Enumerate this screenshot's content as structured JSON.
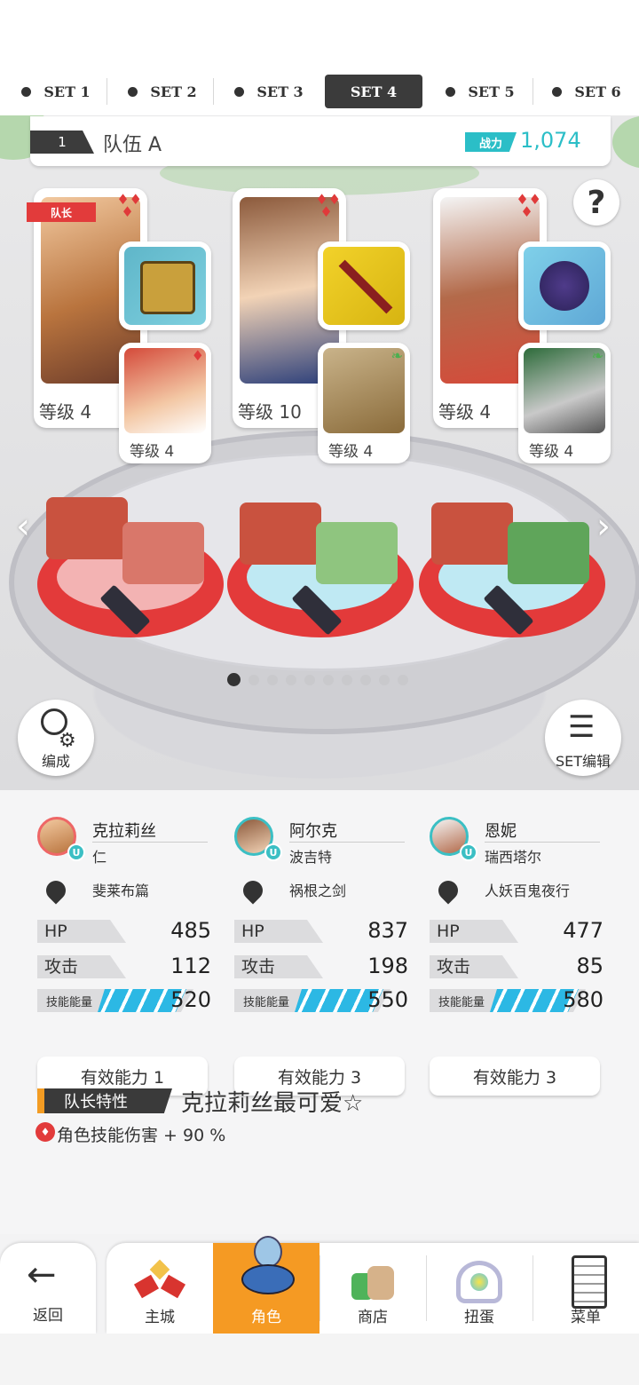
{
  "tabs": [
    {
      "label": "SET 1",
      "active": false
    },
    {
      "label": "SET 2",
      "active": false
    },
    {
      "label": "SET 3",
      "active": false
    },
    {
      "label": "SET 4",
      "active": true
    },
    {
      "label": "SET 5",
      "active": false
    },
    {
      "label": "SET 6",
      "active": false
    }
  ],
  "team": {
    "number": "1",
    "name": "队伍 A",
    "power_label": "战力",
    "power_value": "1,074"
  },
  "cards": [
    {
      "leader_tag": "队长",
      "level": "等级 4",
      "sub_level": "等级 4"
    },
    {
      "level": "等级 10",
      "sub_level": "等级 4"
    },
    {
      "level": "等级 4",
      "sub_level": "等级 4"
    }
  ],
  "help_label": "?",
  "edit_button": "编成",
  "set_edit_button": "SET编辑",
  "pager": {
    "pages": 10,
    "current": 1
  },
  "characters": [
    {
      "name": "克拉莉丝",
      "partner": "仁",
      "weapon": "斐莱布篇",
      "hp_label": "HP",
      "hp": "485",
      "atk_label": "攻击",
      "atk": "112",
      "energy_label": "技能能量",
      "energy": "520",
      "ability": "有效能力 1"
    },
    {
      "name": "阿尔克",
      "partner": "波吉特",
      "weapon": "祸根之剑",
      "hp_label": "HP",
      "hp": "837",
      "atk_label": "攻击",
      "atk": "198",
      "energy_label": "技能能量",
      "energy": "550",
      "ability": "有效能力 3"
    },
    {
      "name": "恩妮",
      "partner": "瑞西塔尔",
      "weapon": "人妖百鬼夜行",
      "hp_label": "HP",
      "hp": "477",
      "atk_label": "攻击",
      "atk": "85",
      "energy_label": "技能能量",
      "energy": "580",
      "ability": "有效能力 3"
    }
  ],
  "leader_skill": {
    "label": "队长特性",
    "name": "克拉莉丝最可爱☆",
    "effect": "角色技能伤害 + 90 %"
  },
  "nav": {
    "back": "返回",
    "items": [
      "主城",
      "角色",
      "商店",
      "扭蛋",
      "菜单"
    ],
    "active": "角色"
  },
  "colors": {
    "accent": "#f59a23",
    "power": "#2bbec7",
    "suit": "#e03a3a",
    "energy": "#2cb8e4"
  }
}
